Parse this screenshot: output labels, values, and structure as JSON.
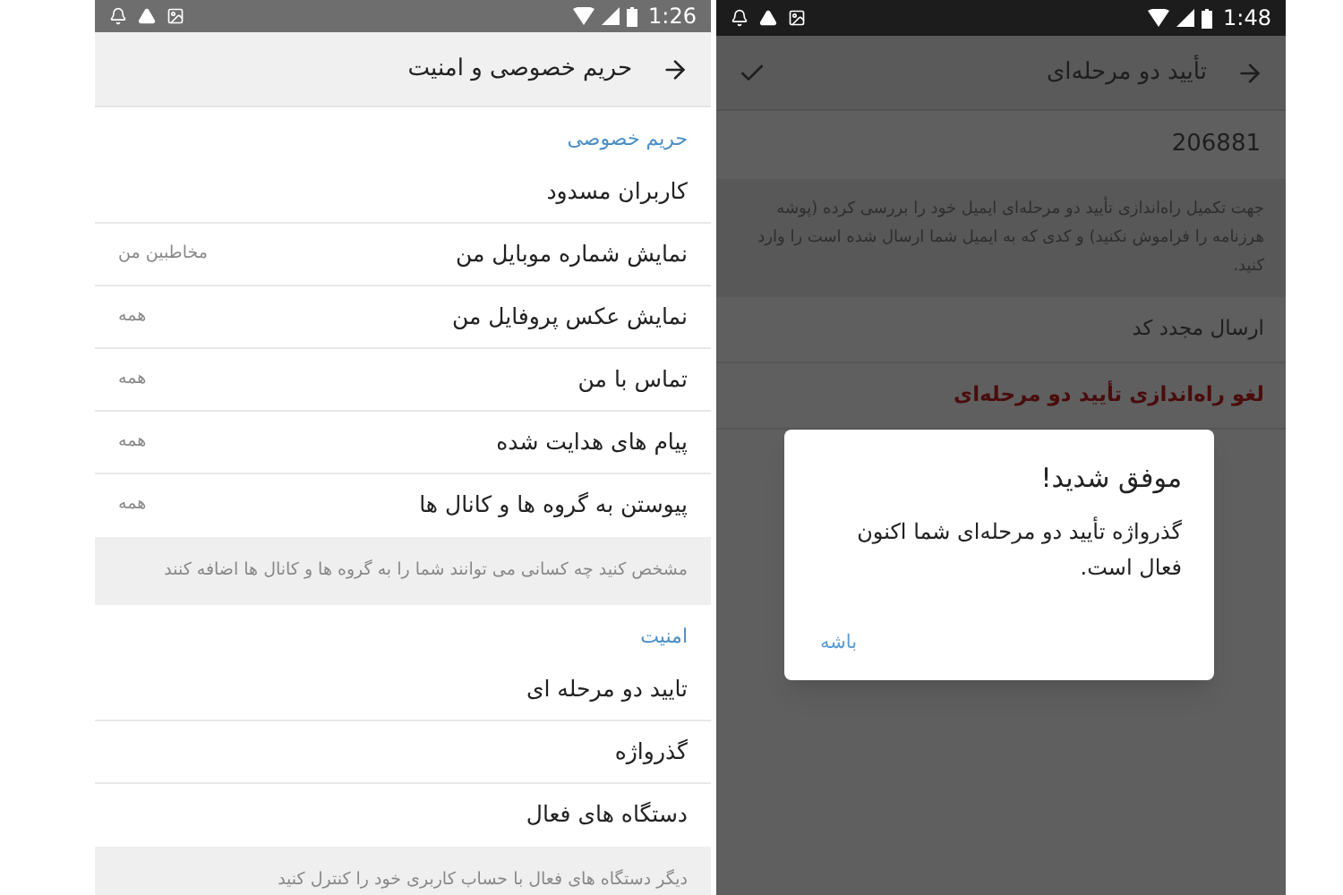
{
  "privacy_screen": {
    "status_bar": {
      "time": "1:26"
    },
    "toolbar": {
      "title": "حریم خصوصی و امنیت"
    },
    "sections": [
      {
        "header": "حریم خصوصی",
        "items": [
          {
            "label": "کاربران مسدود"
          },
          {
            "label": "نمایش شماره موبایل من",
            "value": "مخاطبین من"
          },
          {
            "label": "نمایش عکس پروفایل من",
            "value": "همه"
          },
          {
            "label": "تماس با من",
            "value": "همه"
          },
          {
            "label": "پیام های هدایت شده",
            "value": "همه"
          },
          {
            "label": "پیوستن به گروه ها و کانال ها",
            "value": "همه"
          }
        ],
        "footer": "مشخص کنید چه کسانی می توانند شما را به گروه ها و کانال ها اضافه کنند"
      },
      {
        "header": "امنیت",
        "items": [
          {
            "label": "تایید دو مرحله ای"
          },
          {
            "label": "گذرواژه"
          },
          {
            "label": "دستگاه های فعال"
          }
        ],
        "footer": "دیگر دستگاه های فعال با حساب کاربری خود را کنترل کنید"
      }
    ]
  },
  "two_step_screen": {
    "status_bar": {
      "time": "1:48"
    },
    "toolbar": {
      "title": "تأیید دو مرحله‌ای"
    },
    "code_field": {
      "value": "206881"
    },
    "hint": "جهت تکمیل راه‌اندازی تأیید دو مرحله‌ای ایمیل خود را بررسی کرده (پوشه هرزنامه را فراموش نکنید) و کدی که به ایمیل شما ارسال شده است را وارد کنید.",
    "items": [
      {
        "label": "ارسال مجدد کد",
        "kind": "normal"
      },
      {
        "label": "لغو راه‌اندازی تأیید دو مرحله‌ای",
        "kind": "danger"
      }
    ],
    "dialog": {
      "title": "موفق شدید!",
      "message": "گذرواژه تأیید دو مرحله‌ای شما اکنون فعال است.",
      "button": "باشه"
    }
  }
}
